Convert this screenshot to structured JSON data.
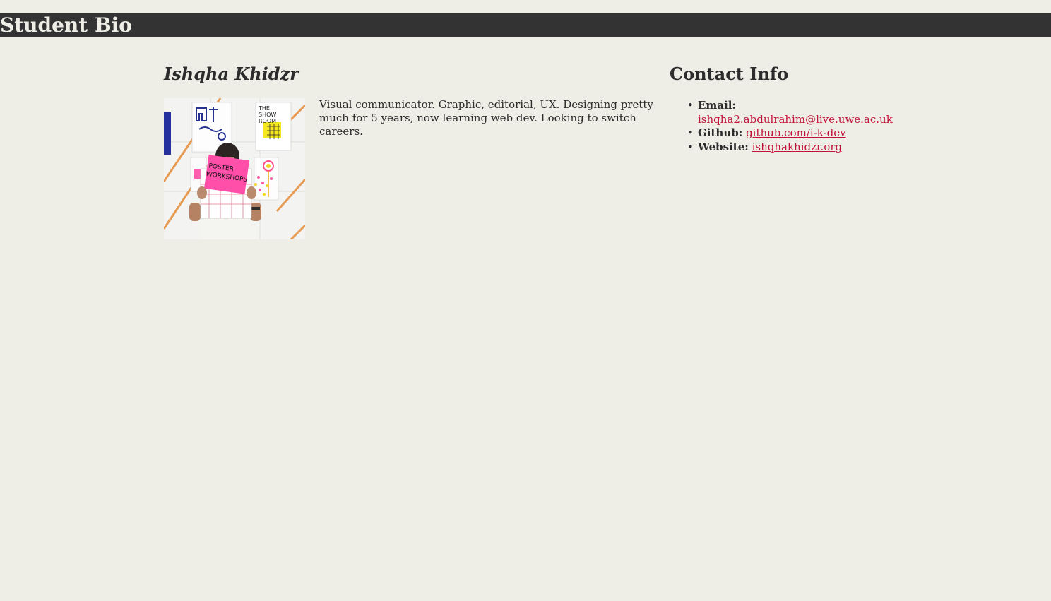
{
  "header": {
    "title": "Student Bio"
  },
  "student": {
    "name": "Ishqha Khidzr",
    "bio": "Visual communicator. Graphic, editorial, UX. Designing pretty much for 5 years, now learning web dev. Looking to switch careers.",
    "photo": {
      "poster_text_1": "THE SHOW ROOM",
      "poster_text_2": "POSTER WORKSHOPS"
    }
  },
  "contact": {
    "heading": "Contact Info",
    "items": [
      {
        "label": "Email:",
        "value": "ishqha2.abdulrahim@live.uwe.ac.uk"
      },
      {
        "label": "Github:",
        "value": "github.com/i-k-dev"
      },
      {
        "label": "Website:",
        "value": "ishqhakhidzr.org"
      }
    ]
  },
  "colors": {
    "page_background": "#eeede6",
    "header_background": "#333333",
    "text": "#2c2c2c",
    "link": "#c1123a",
    "poster_pink": "#ff4fa8",
    "poster_yellow": "#f5e71d",
    "tape_orange": "#e79a52"
  }
}
